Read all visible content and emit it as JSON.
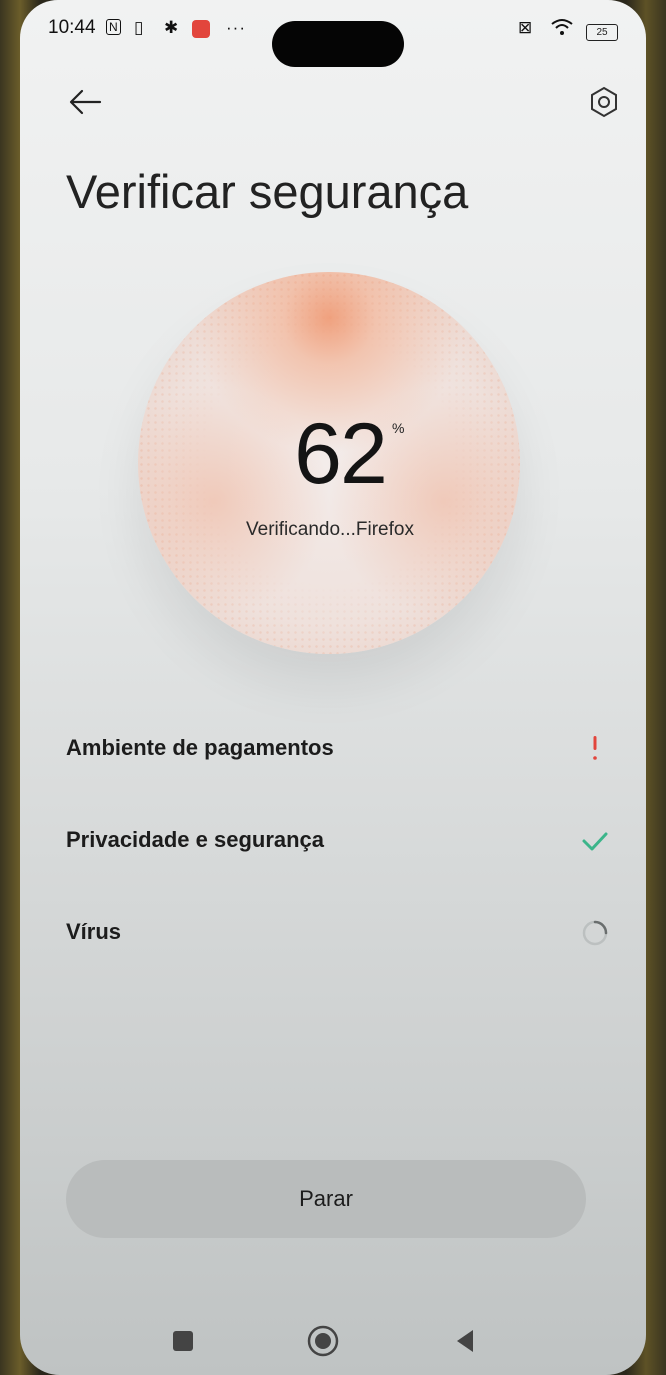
{
  "status_bar": {
    "time": "10:44",
    "more_indicator": "···",
    "battery_level": "25",
    "icons": [
      "nfc-icon",
      "sim-icon",
      "settings-gear-icon",
      "notification-app-icon",
      "sim-disabled-icon",
      "wifi-icon",
      "battery-icon"
    ]
  },
  "header": {
    "title": "Verificar segurança",
    "back_icon": "arrow-left-icon",
    "settings_icon": "hexagon-settings-icon"
  },
  "progress": {
    "value": "62",
    "unit": "%",
    "status_text": "Verificando...Firefox"
  },
  "checks": [
    {
      "label": "Ambiente de pagamentos",
      "state": "warning",
      "icon": "exclamation-icon"
    },
    {
      "label": "Privacidade e segurança",
      "state": "done",
      "icon": "checkmark-icon"
    },
    {
      "label": "Vírus",
      "state": "in-progress",
      "icon": "spinner-icon"
    }
  ],
  "actions": {
    "stop_label": "Parar"
  },
  "navigation": {
    "recents_icon": "square-icon",
    "home_icon": "circle-icon",
    "back_icon": "triangle-back-icon"
  },
  "colors": {
    "accent_orange": "#ef8f63",
    "check_green": "#3bb58a",
    "warning_red": "#e2453c"
  }
}
